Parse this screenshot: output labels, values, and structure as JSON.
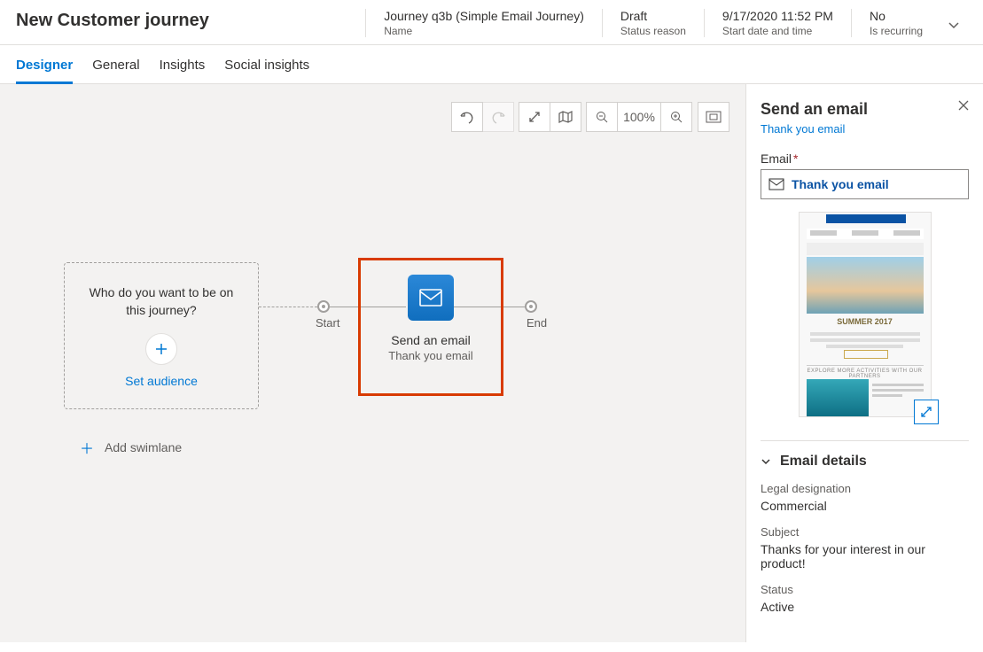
{
  "header": {
    "title": "New Customer journey",
    "fields": [
      {
        "value": "Journey q3b (Simple Email Journey)",
        "label": "Name"
      },
      {
        "value": "Draft",
        "label": "Status reason"
      },
      {
        "value": "9/17/2020 11:52 PM",
        "label": "Start date and time"
      },
      {
        "value": "No",
        "label": "Is recurring"
      }
    ]
  },
  "tabs": [
    "Designer",
    "General",
    "Insights",
    "Social insights"
  ],
  "active_tab": 0,
  "toolbar": {
    "zoom": "100%"
  },
  "canvas": {
    "audience_prompt_line1": "Who do you want to be on",
    "audience_prompt_line2": "this journey?",
    "set_audience": "Set audience",
    "start_label": "Start",
    "end_label": "End",
    "email_tile": {
      "title": "Send an email",
      "subtitle": "Thank you email"
    },
    "add_swimlane": "Add swimlane"
  },
  "side": {
    "title": "Send an email",
    "link": "Thank you email",
    "email_label": "Email",
    "email_value": "Thank you email",
    "preview": {
      "headline": "SUMMER 2017",
      "footer": "EXPLORE MORE ACTIVITIES WITH OUR PARTNERS"
    },
    "details": {
      "section": "Email details",
      "legal_label": "Legal designation",
      "legal_value": "Commercial",
      "subject_label": "Subject",
      "subject_value": "Thanks for your interest in our product!",
      "status_label": "Status",
      "status_value": "Active"
    }
  }
}
